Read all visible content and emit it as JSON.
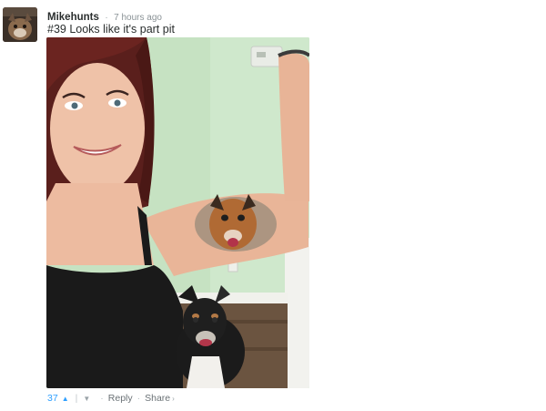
{
  "comment": {
    "username": "Mikehunts",
    "separator": "·",
    "timestamp": "7 hours ago",
    "text": "#39 Looks like it's part pit"
  },
  "footer": {
    "vote_count": "37",
    "upvote_icon": "^",
    "divider": "|",
    "downvote_icon": "v",
    "dot": "·",
    "reply_label": "Reply",
    "share_label": "Share",
    "share_chevron": "›"
  },
  "colors": {
    "accent": "#2e9fff",
    "text": "#2a2e2e",
    "muted": "#8a9296"
  },
  "icons": [
    "avatar",
    "upvote-icon",
    "downvote-icon",
    "share-chevron-icon"
  ]
}
